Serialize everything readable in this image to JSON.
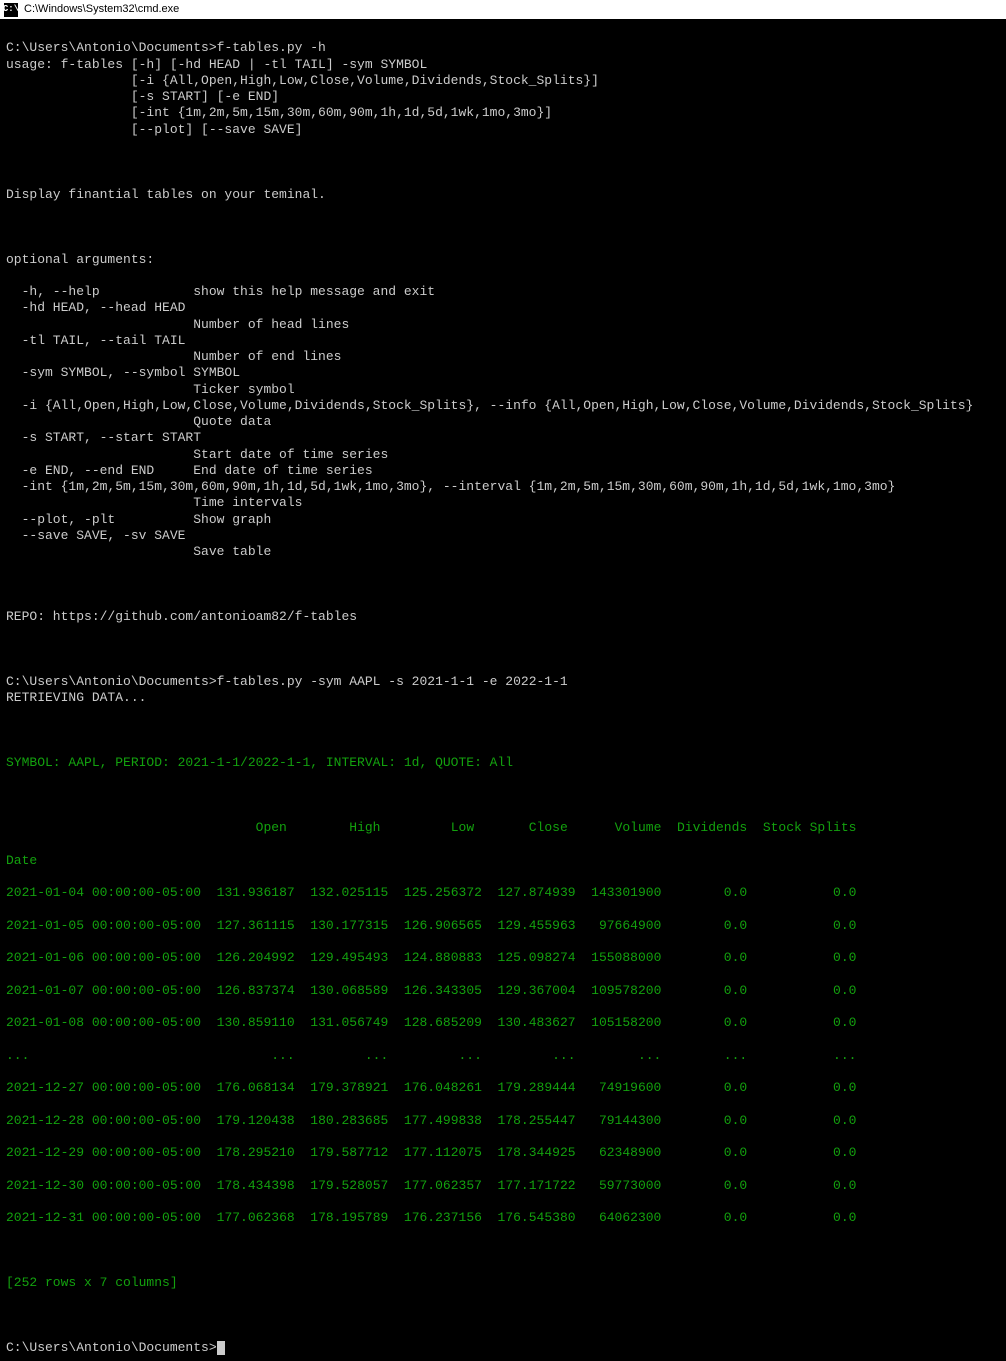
{
  "titlebar": {
    "icon_label": "C:\\",
    "title": "C:\\Windows\\System32\\cmd.exe"
  },
  "session": {
    "prompt_path": "C:\\Users\\Antonio\\Documents>",
    "cmd_help": "f-tables.py -h",
    "usage_lines": [
      "usage: f-tables [-h] [-hd HEAD | -tl TAIL] -sym SYMBOL",
      "                [-i {All,Open,High,Low,Close,Volume,Dividends,Stock_Splits}]",
      "                [-s START] [-e END]",
      "                [-int {1m,2m,5m,15m,30m,60m,90m,1h,1d,5d,1wk,1mo,3mo}]",
      "                [--plot] [--save SAVE]"
    ],
    "description": "Display finantial tables on your teminal.",
    "optional_header": "optional arguments:",
    "args": [
      "  -h, --help            show this help message and exit",
      "  -hd HEAD, --head HEAD",
      "                        Number of head lines",
      "  -tl TAIL, --tail TAIL",
      "                        Number of end lines",
      "  -sym SYMBOL, --symbol SYMBOL",
      "                        Ticker symbol",
      "  -i {All,Open,High,Low,Close,Volume,Dividends,Stock_Splits}, --info {All,Open,High,Low,Close,Volume,Dividends,Stock_Splits}",
      "                        Quote data",
      "  -s START, --start START",
      "                        Start date of time series",
      "  -e END, --end END     End date of time series",
      "  -int {1m,2m,5m,15m,30m,60m,90m,1h,1d,5d,1wk,1mo,3mo}, --interval {1m,2m,5m,15m,30m,60m,90m,1h,1d,5d,1wk,1mo,3mo}",
      "                        Time intervals",
      "  --plot, -plt          Show graph",
      "  --save SAVE, -sv SAVE",
      "                        Save table"
    ],
    "repo_line": "REPO: https://github.com/antonioam82/f-tables",
    "cmd_query": "f-tables.py -sym AAPL -s 2021-1-1 -e 2022-1-1",
    "retrieving": "RETRIEVING DATA...",
    "summary_line": "SYMBOL: AAPL, PERIOD: 2021-1-1/2022-1-1, INTERVAL: 1d, QUOTE: All",
    "table": {
      "index_label": "Date",
      "headers": [
        "Open",
        "High",
        "Low",
        "Close",
        "Volume",
        "Dividends",
        "Stock Splits"
      ],
      "rows_top": [
        {
          "date": "2021-01-04 00:00:00-05:00",
          "open": "131.936187",
          "high": "132.025115",
          "low": "125.256372",
          "close": "127.874939",
          "volume": "143301900",
          "dividends": "0.0",
          "splits": "0.0"
        },
        {
          "date": "2021-01-05 00:00:00-05:00",
          "open": "127.361115",
          "high": "130.177315",
          "low": "126.906565",
          "close": "129.455963",
          "volume": "97664900",
          "dividends": "0.0",
          "splits": "0.0"
        },
        {
          "date": "2021-01-06 00:00:00-05:00",
          "open": "126.204992",
          "high": "129.495493",
          "low": "124.880883",
          "close": "125.098274",
          "volume": "155088000",
          "dividends": "0.0",
          "splits": "0.0"
        },
        {
          "date": "2021-01-07 00:00:00-05:00",
          "open": "126.837374",
          "high": "130.068589",
          "low": "126.343305",
          "close": "129.367004",
          "volume": "109578200",
          "dividends": "0.0",
          "splits": "0.0"
        },
        {
          "date": "2021-01-08 00:00:00-05:00",
          "open": "130.859110",
          "high": "131.056749",
          "low": "128.685209",
          "close": "130.483627",
          "volume": "105158200",
          "dividends": "0.0",
          "splits": "0.0"
        }
      ],
      "ellipsis": {
        "date": "...",
        "open": "...",
        "high": "...",
        "low": "...",
        "close": "...",
        "volume": "...",
        "dividends": "...",
        "splits": "..."
      },
      "rows_bottom": [
        {
          "date": "2021-12-27 00:00:00-05:00",
          "open": "176.068134",
          "high": "179.378921",
          "low": "176.048261",
          "close": "179.289444",
          "volume": "74919600",
          "dividends": "0.0",
          "splits": "0.0"
        },
        {
          "date": "2021-12-28 00:00:00-05:00",
          "open": "179.120438",
          "high": "180.283685",
          "low": "177.499838",
          "close": "178.255447",
          "volume": "79144300",
          "dividends": "0.0",
          "splits": "0.0"
        },
        {
          "date": "2021-12-29 00:00:00-05:00",
          "open": "178.295210",
          "high": "179.587712",
          "low": "177.112075",
          "close": "178.344925",
          "volume": "62348900",
          "dividends": "0.0",
          "splits": "0.0"
        },
        {
          "date": "2021-12-30 00:00:00-05:00",
          "open": "178.434398",
          "high": "179.528057",
          "low": "177.062357",
          "close": "177.171722",
          "volume": "59773000",
          "dividends": "0.0",
          "splits": "0.0"
        },
        {
          "date": "2021-12-31 00:00:00-05:00",
          "open": "177.062368",
          "high": "178.195789",
          "low": "176.237156",
          "close": "176.545380",
          "volume": "64062300",
          "dividends": "0.0",
          "splits": "0.0"
        }
      ],
      "shape_line": "[252 rows x 7 columns]"
    },
    "final_prompt": "C:\\Users\\Antonio\\Documents>"
  },
  "chart_data": {
    "type": "table",
    "title": "SYMBOL: AAPL, PERIOD: 2021-1-1/2022-1-1, INTERVAL: 1d, QUOTE: All",
    "columns": [
      "Date",
      "Open",
      "High",
      "Low",
      "Close",
      "Volume",
      "Dividends",
      "Stock Splits"
    ],
    "rows_shown": 10,
    "rows_total": 252,
    "data": [
      [
        "2021-01-04 00:00:00-05:00",
        131.936187,
        132.025115,
        125.256372,
        127.874939,
        143301900,
        0.0,
        0.0
      ],
      [
        "2021-01-05 00:00:00-05:00",
        127.361115,
        130.177315,
        126.906565,
        129.455963,
        97664900,
        0.0,
        0.0
      ],
      [
        "2021-01-06 00:00:00-05:00",
        126.204992,
        129.495493,
        124.880883,
        125.098274,
        155088000,
        0.0,
        0.0
      ],
      [
        "2021-01-07 00:00:00-05:00",
        126.837374,
        130.068589,
        126.343305,
        129.367004,
        109578200,
        0.0,
        0.0
      ],
      [
        "2021-01-08 00:00:00-05:00",
        130.85911,
        131.056749,
        128.685209,
        130.483627,
        105158200,
        0.0,
        0.0
      ],
      [
        "2021-12-27 00:00:00-05:00",
        176.068134,
        179.378921,
        176.048261,
        179.289444,
        74919600,
        0.0,
        0.0
      ],
      [
        "2021-12-28 00:00:00-05:00",
        179.120438,
        180.283685,
        177.499838,
        178.255447,
        79144300,
        0.0,
        0.0
      ],
      [
        "2021-12-29 00:00:00-05:00",
        178.29521,
        179.587712,
        177.112075,
        178.344925,
        62348900,
        0.0,
        0.0
      ],
      [
        "2021-12-30 00:00:00-05:00",
        178.434398,
        179.528057,
        177.062357,
        177.171722,
        59773000,
        0.0,
        0.0
      ],
      [
        "2021-12-31 00:00:00-05:00",
        177.062368,
        178.195789,
        176.237156,
        176.54538,
        64062300,
        0.0,
        0.0
      ]
    ]
  }
}
